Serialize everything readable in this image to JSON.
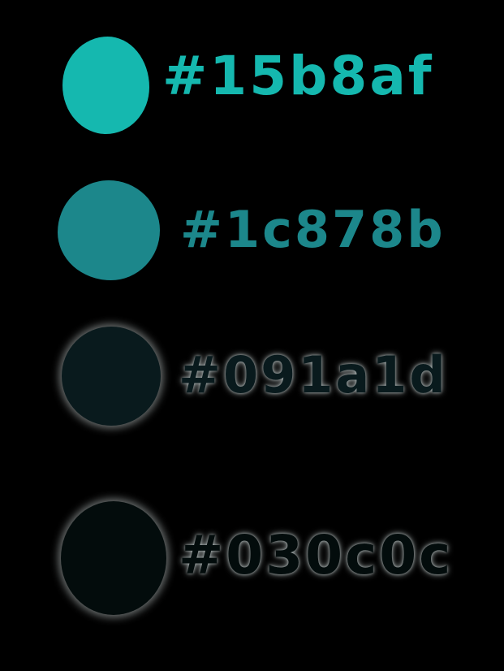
{
  "palette": [
    {
      "label": "#15b8af",
      "color": "#15b8af"
    },
    {
      "label": "#1c878b",
      "color": "#1c878b"
    },
    {
      "label": "#091a1d",
      "color": "#091a1d"
    },
    {
      "label": "#030c0c",
      "color": "#030c0c"
    }
  ],
  "background": "#000000"
}
